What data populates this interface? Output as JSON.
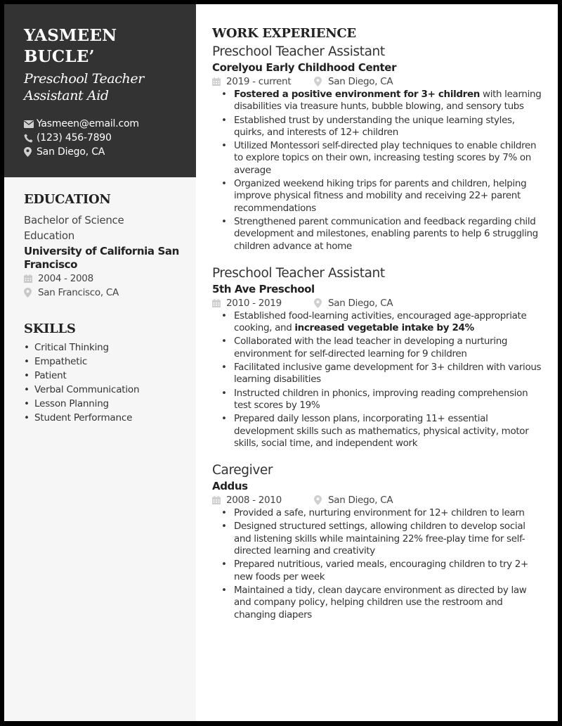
{
  "header": {
    "name_line1": "YASMEEN",
    "name_line2": "BUCLE’",
    "title_line1": "Preschool Teacher",
    "title_line2": "Assistant Aid",
    "contact": {
      "email": "Yasmeen@email.com",
      "phone": "(123) 456-7890",
      "location": "San Diego, CA"
    }
  },
  "education": {
    "heading": "EDUCATION",
    "degree_line1": "Bachelor of Science",
    "degree_line2": "Education",
    "school": "University of California San Francisco",
    "dates": "2004 - 2008",
    "location": "San Francisco, CA"
  },
  "skills": {
    "heading": "SKILLS",
    "items": [
      "Critical Thinking",
      "Empathetic",
      "Patient",
      "Verbal Communication",
      "Lesson Planning",
      "Student Performance"
    ]
  },
  "work": {
    "heading": "WORK EXPERIENCE",
    "jobs": [
      {
        "title": "Preschool Teacher Assistant",
        "company": "Corelyou Early Childhood Center",
        "dates": "2019 - current",
        "location": "San Diego, CA",
        "bullets": [
          {
            "bold": "Fostered a positive environment for 3+ children",
            "text": " with learning disabilities via treasure hunts, bubble blowing, and sensory tubs"
          },
          {
            "text": "Established trust by understanding the unique learning styles, quirks, and interests of 12+ children"
          },
          {
            "text": "Utilized Montessori self-directed play techniques to enable children to explore topics on their own, increasing testing scores by 7% on average"
          },
          {
            "text": "Organized weekend hiking trips for parents and children, helping improve physical fitness and mobility and receiving 22+ parent recommendations"
          },
          {
            "text": "Strengthened parent communication and feedback regarding child development and milestones, enabling parents to help 6 struggling children advance at home"
          }
        ]
      },
      {
        "title": "Preschool Teacher Assistant",
        "company": "5th Ave Preschool",
        "dates": "2010 - 2019",
        "location": "San Diego, CA",
        "bullets": [
          {
            "text": "Established food-learning activities, encouraged age-appropriate cooking, and ",
            "bold_end": "increased vegetable intake by 24%"
          },
          {
            "text": "Collaborated with the lead teacher in developing a nurturing environment for self-directed learning for 9 children"
          },
          {
            "text": "Facilitated inclusive game development for 3+ children with various learning disabilities"
          },
          {
            "text": "Instructed children in phonics, improving reading comprehension test scores by 19%"
          },
          {
            "text": "Prepared daily lesson plans, incorporating 11+ essential development skills such as mathematics, physical activity, motor skills, social time, and independent work"
          }
        ]
      },
      {
        "title": "Caregiver",
        "company": "Addus",
        "dates": "2008 - 2010",
        "location": "San Diego, CA",
        "bullets": [
          {
            "text": "Provided a safe, nurturing environment for 12+ children to learn"
          },
          {
            "text": "Designed structured settings, allowing children to develop social and listening skills while maintaining 22% free-play time for self-directed learning and creativity"
          },
          {
            "text": "Prepared nutritious, varied meals, encouraging children to try 2+ new foods per week"
          },
          {
            "text": "Maintained a tidy, clean daycare environment as directed by law and company policy, helping children use the restroom and changing diapers"
          }
        ]
      }
    ]
  }
}
